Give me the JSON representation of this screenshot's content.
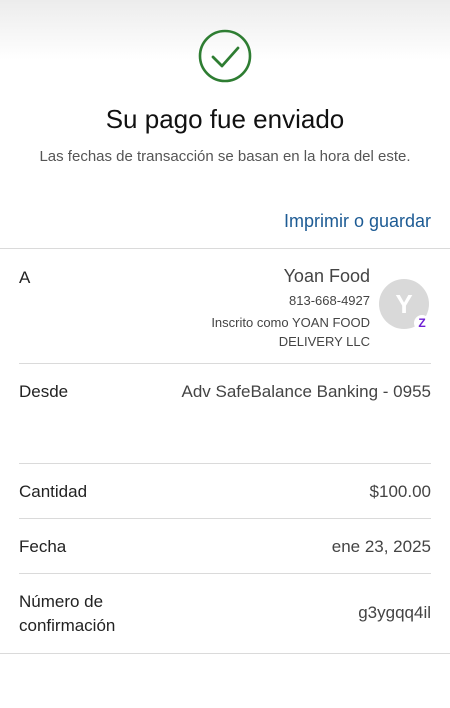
{
  "header": {
    "status_icon": "check-circle-icon",
    "accent_color": "#2e7d32",
    "title": "Su pago fue enviado",
    "subtitle": "Las fechas de transacción se basan en la hora del este.",
    "print_link": "Imprimir o guardar",
    "link_color": "#1d5b94"
  },
  "details": {
    "to": {
      "label": "A",
      "name": "Yoan Food",
      "phone": "813-668-4927",
      "registered_as": "Inscrito como YOAN FOOD DELIVERY LLC",
      "avatar_initial": "Y",
      "badge_icon": "zelle-icon",
      "badge_glyph": "Z"
    },
    "from": {
      "label": "Desde",
      "value": "Adv SafeBalance Banking - 0955"
    },
    "amount": {
      "label": "Cantidad",
      "value": "$100.00"
    },
    "date": {
      "label": "Fecha",
      "value": "ene 23, 2025"
    },
    "confirmation": {
      "label": "Número de confirmación",
      "value": "g3ygqq4il"
    }
  }
}
